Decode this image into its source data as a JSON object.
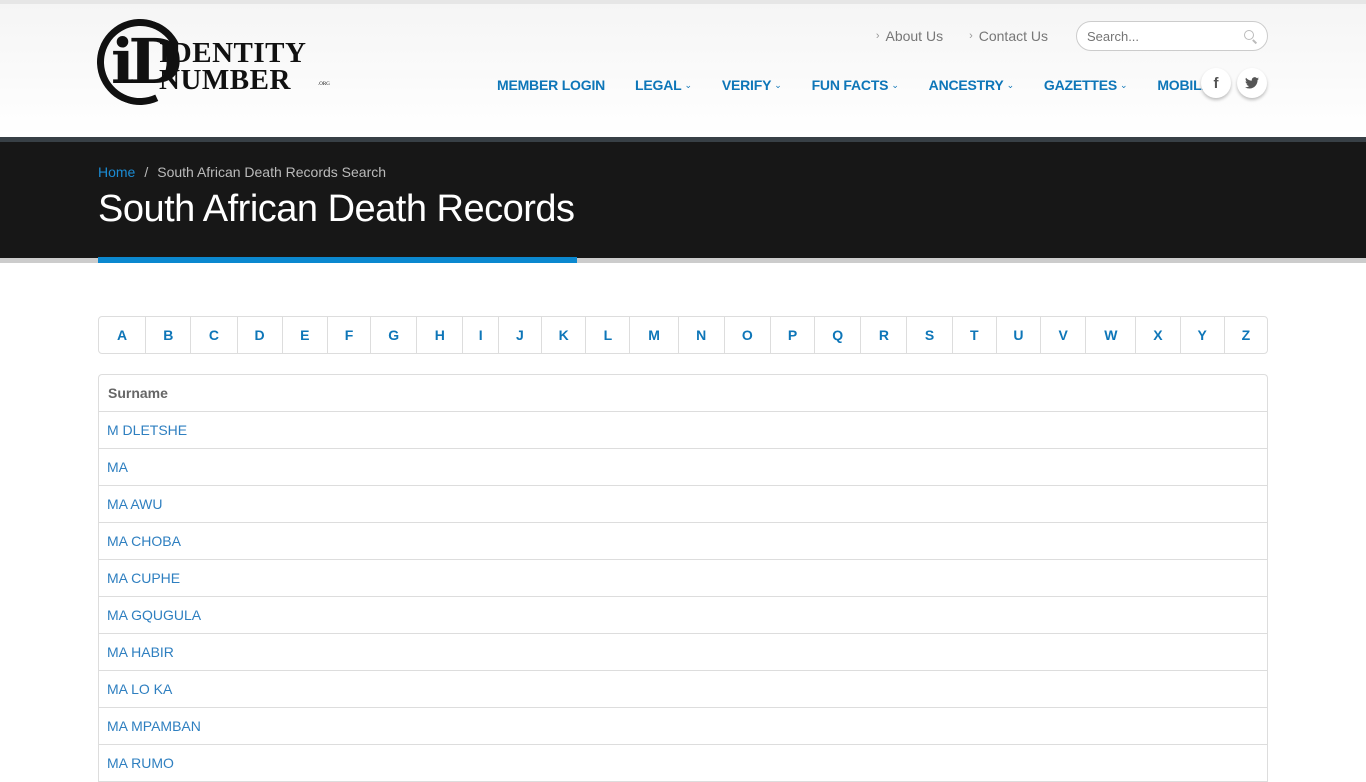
{
  "logo": {
    "mark": "iD",
    "line1": "IDENTITY",
    "line2": "NUMBER",
    "suffix": ".ORG"
  },
  "toplinks": [
    {
      "label": "About Us",
      "icon": "chevron-right-icon"
    },
    {
      "label": "Contact Us",
      "icon": "chevron-right-icon"
    }
  ],
  "search": {
    "placeholder": "Search...",
    "icon": "search-icon"
  },
  "mainnav": [
    {
      "label": "MEMBER LOGIN",
      "dropdown": false
    },
    {
      "label": "LEGAL",
      "dropdown": true
    },
    {
      "label": "VERIFY",
      "dropdown": true
    },
    {
      "label": "FUN FACTS",
      "dropdown": true
    },
    {
      "label": "ANCESTRY",
      "dropdown": true
    },
    {
      "label": "GAZETTES",
      "dropdown": true
    },
    {
      "label": "MOBILE",
      "dropdown": false
    }
  ],
  "dropdown_glyph": "⌄",
  "social": {
    "facebook": "f",
    "twitter": "🐦"
  },
  "breadcrumb": {
    "home": "Home",
    "separator": "/",
    "current": "South African Death Records Search"
  },
  "page_title": "South African Death Records",
  "letters": [
    "A",
    "B",
    "C",
    "D",
    "E",
    "F",
    "G",
    "H",
    "I",
    "J",
    "K",
    "L",
    "M",
    "N",
    "O",
    "P",
    "Q",
    "R",
    "S",
    "T",
    "U",
    "V",
    "W",
    "X",
    "Y",
    "Z"
  ],
  "table": {
    "header": "Surname",
    "rows": [
      "M DLETSHE",
      "MA",
      "MA AWU",
      "MA CHOBA",
      "MA CUPHE",
      "MA GQUGULA",
      "MA HABIR",
      "MA LO KA",
      "MA MPAMBAN",
      "MA RUMO"
    ]
  },
  "colors": {
    "link": "#0e76b8",
    "accent": "#0b88cf",
    "banner": "#171717"
  }
}
